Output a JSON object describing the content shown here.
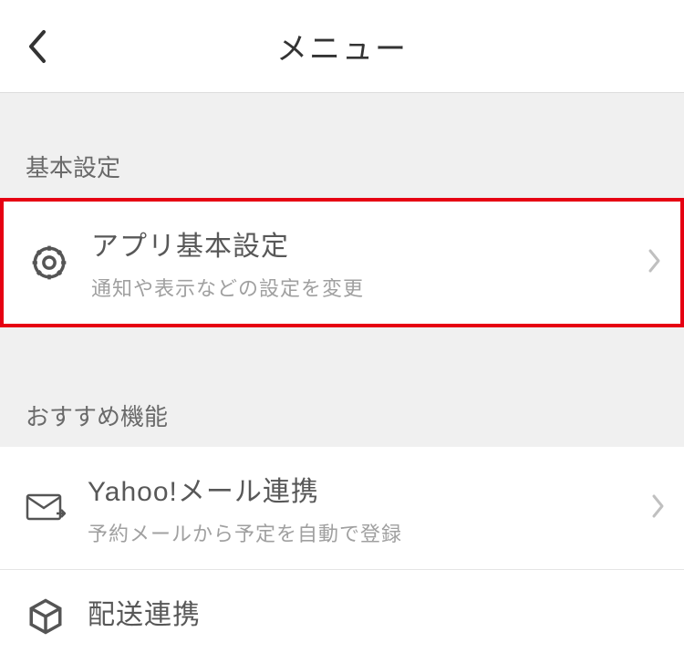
{
  "header": {
    "title": "メニュー"
  },
  "sections": [
    {
      "header": "基本設定",
      "items": [
        {
          "title": "アプリ基本設定",
          "subtitle": "通知や表示などの設定を変更"
        }
      ]
    },
    {
      "header": "おすすめ機能",
      "items": [
        {
          "title": "Yahoo!メール連携",
          "subtitle": "予約メールから予定を自動で登録"
        },
        {
          "title": "配送連携",
          "subtitle": ""
        }
      ]
    }
  ]
}
